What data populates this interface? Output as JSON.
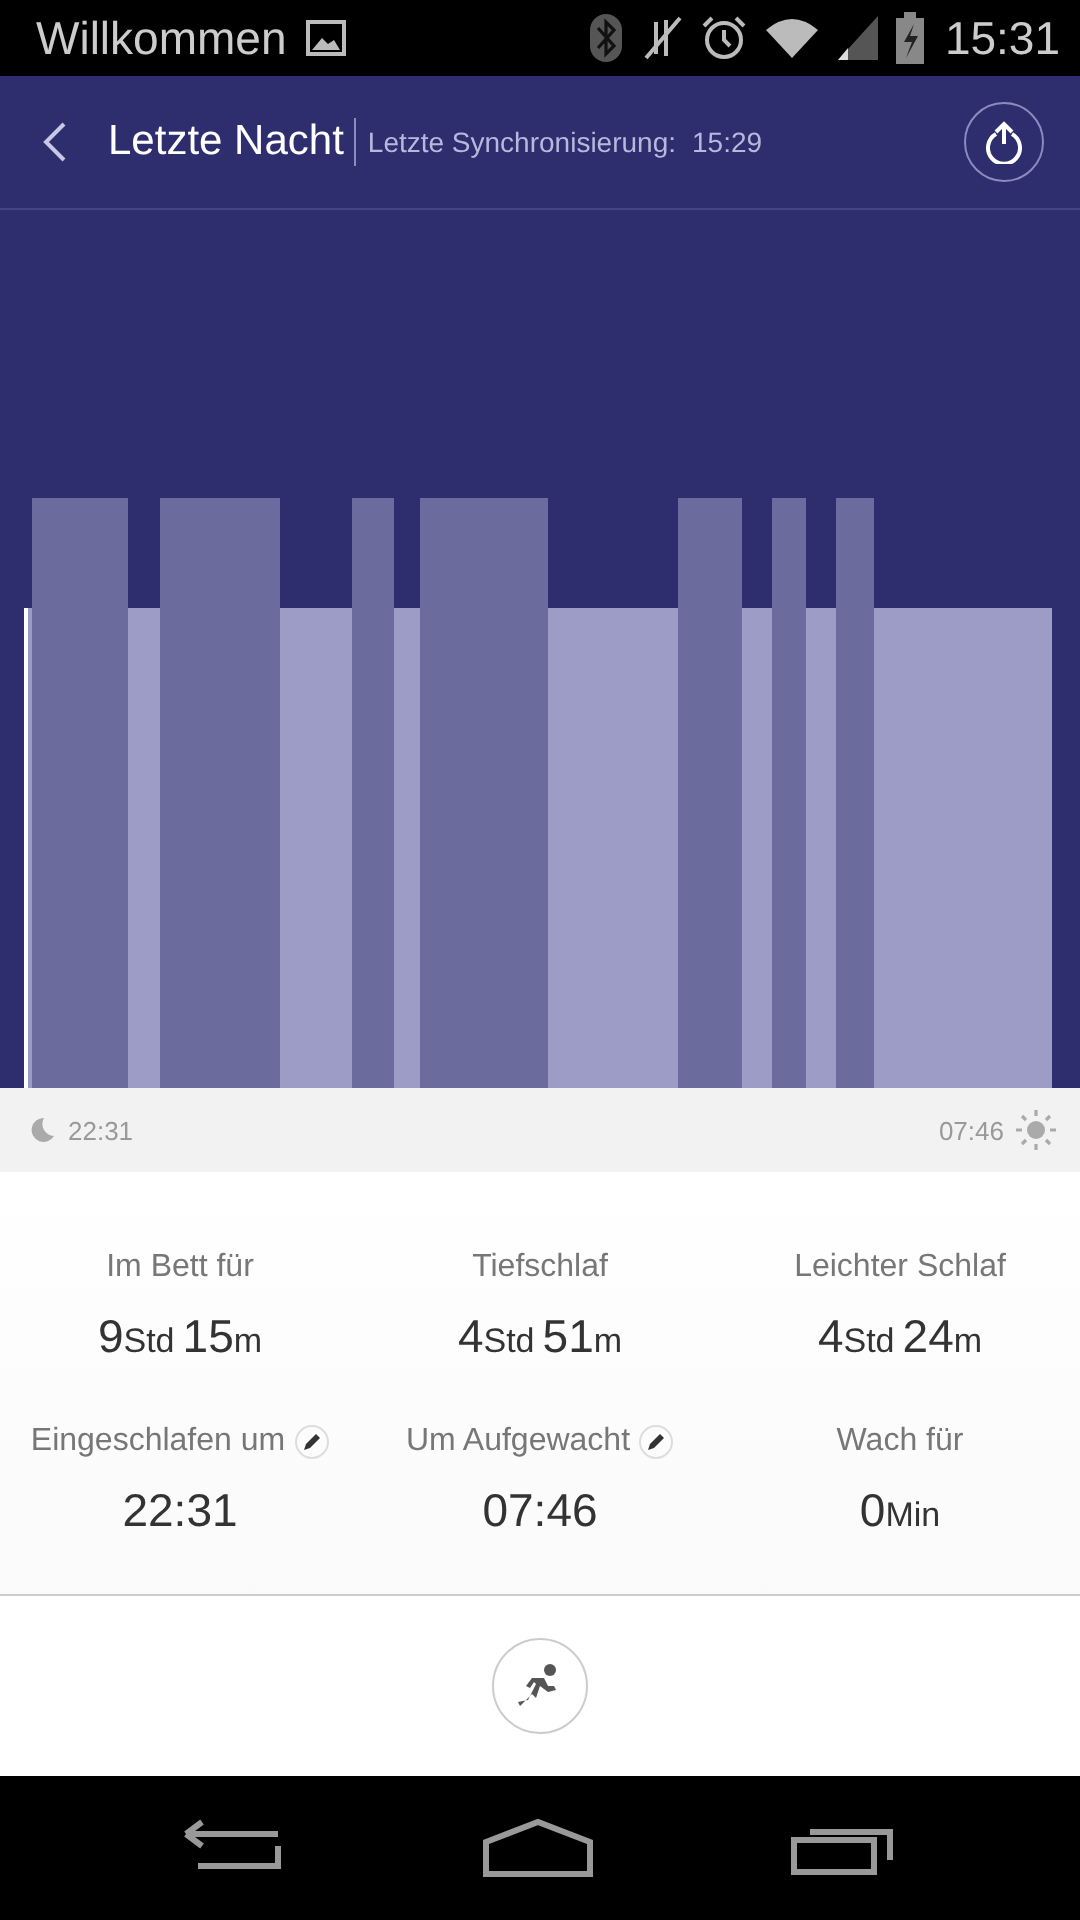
{
  "status_bar": {
    "title": "Willkommen",
    "time": "15:31"
  },
  "header": {
    "title": "Letzte Nacht",
    "sync_label": "Letzte Synchronisierung:",
    "sync_time": "15:29"
  },
  "timeline": {
    "start": "22:31",
    "end": "07:46"
  },
  "stats": [
    {
      "label": "Im Bett für",
      "editable": false,
      "parts": [
        {
          "text": "9",
          "kind": "number"
        },
        {
          "text": "Std",
          "kind": "unit"
        },
        {
          "text": "15",
          "kind": "number"
        },
        {
          "text": "m",
          "kind": "unit"
        }
      ]
    },
    {
      "label": "Tiefschlaf",
      "editable": false,
      "parts": [
        {
          "text": "4",
          "kind": "number"
        },
        {
          "text": "Std",
          "kind": "unit"
        },
        {
          "text": "51",
          "kind": "number"
        },
        {
          "text": "m",
          "kind": "unit"
        }
      ]
    },
    {
      "label": "Leichter Schlaf",
      "editable": false,
      "parts": [
        {
          "text": "4",
          "kind": "number"
        },
        {
          "text": "Std",
          "kind": "unit"
        },
        {
          "text": "24",
          "kind": "number"
        },
        {
          "text": "m",
          "kind": "unit"
        }
      ]
    },
    {
      "label": "Eingeschlafen um",
      "editable": true,
      "parts": [
        {
          "text": "22:31",
          "kind": "number"
        }
      ]
    },
    {
      "label": "Um Aufgewacht",
      "editable": true,
      "parts": [
        {
          "text": "07:46",
          "kind": "number"
        }
      ]
    },
    {
      "label": "Wach für",
      "editable": false,
      "parts": [
        {
          "text": "0",
          "kind": "number"
        },
        {
          "text": "Min",
          "kind": "unit"
        }
      ]
    }
  ]
}
